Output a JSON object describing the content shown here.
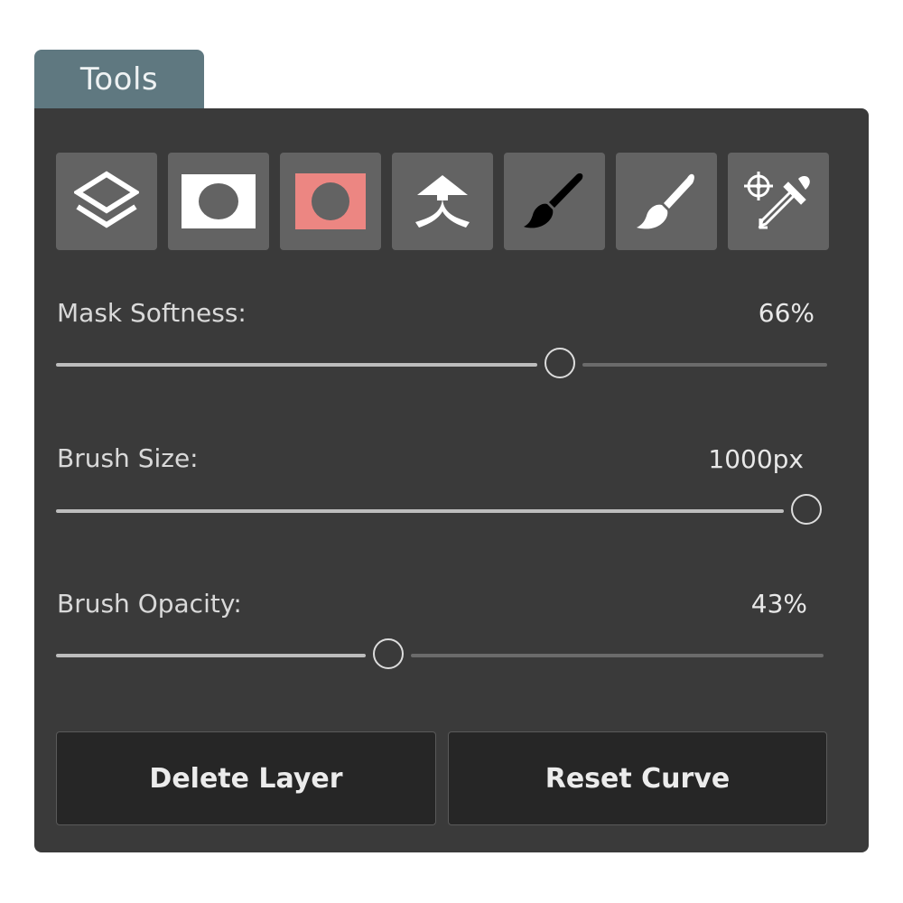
{
  "tab": {
    "title": "Tools"
  },
  "toolbar": {
    "tools": [
      {
        "name": "layers",
        "icon": "layers-icon"
      },
      {
        "name": "mask",
        "icon": "mask-icon"
      },
      {
        "name": "mask-overlay",
        "icon": "mask-overlay-icon",
        "color": "#ec8682"
      },
      {
        "name": "merge",
        "icon": "merge-icon"
      },
      {
        "name": "brush-black",
        "icon": "brush-icon"
      },
      {
        "name": "brush-white",
        "icon": "eraser-brush-icon"
      },
      {
        "name": "eyedropper",
        "icon": "eyedropper-target-icon"
      }
    ]
  },
  "sliders": {
    "mask_softness": {
      "label": "Mask Softness:",
      "value_text": "66%",
      "fraction": 0.66
    },
    "brush_size": {
      "label": "Brush Size:",
      "value_text": "1000px",
      "fraction": 1.0
    },
    "brush_opacity": {
      "label": "Brush Opacity:",
      "value_text": "43%",
      "fraction": 0.43
    }
  },
  "buttons": {
    "delete_layer": "Delete Layer",
    "reset_curve": "Reset Curve"
  },
  "colors": {
    "tab": "#5f7880",
    "panel": "#3a3a3a",
    "tool_bg": "#636363",
    "mask_overlay": "#ec8682",
    "button_bg": "#262626"
  }
}
